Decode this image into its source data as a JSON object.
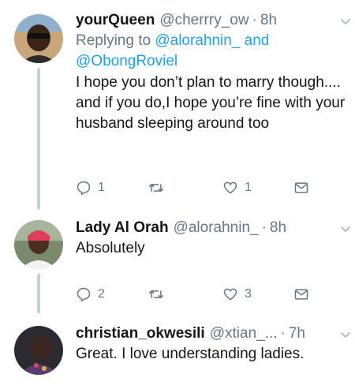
{
  "tweets": [
    {
      "name": "yourQueen",
      "handle": "@cherrry_ow",
      "separator": "·",
      "time": "8h",
      "replying_prefix": "Replying to",
      "replying_mention_1": "@alorahnin_",
      "replying_and": "and",
      "replying_mention_2": "@ObongRoviel",
      "text": "I hope you don’t plan to marry though.... and if you do,I hope you’re fine with your husband sleeping around too",
      "replies": "1",
      "retweets": "",
      "likes": "1"
    },
    {
      "name": "Lady Al Orah",
      "handle": "@alorahnin_",
      "separator": "·",
      "time": "8h",
      "text": "Absolutely",
      "replies": "2",
      "retweets": "",
      "likes": "3"
    },
    {
      "name": "christian_okwesili",
      "handle": "@xtian_...",
      "separator": "·",
      "time": "7h",
      "text": "Great. I love understanding ladies."
    }
  ],
  "colors": {
    "accent": "#1da1f2",
    "secondary_text": "#657786",
    "primary_text": "#14171a",
    "thread_line": "#c4cfd6"
  }
}
